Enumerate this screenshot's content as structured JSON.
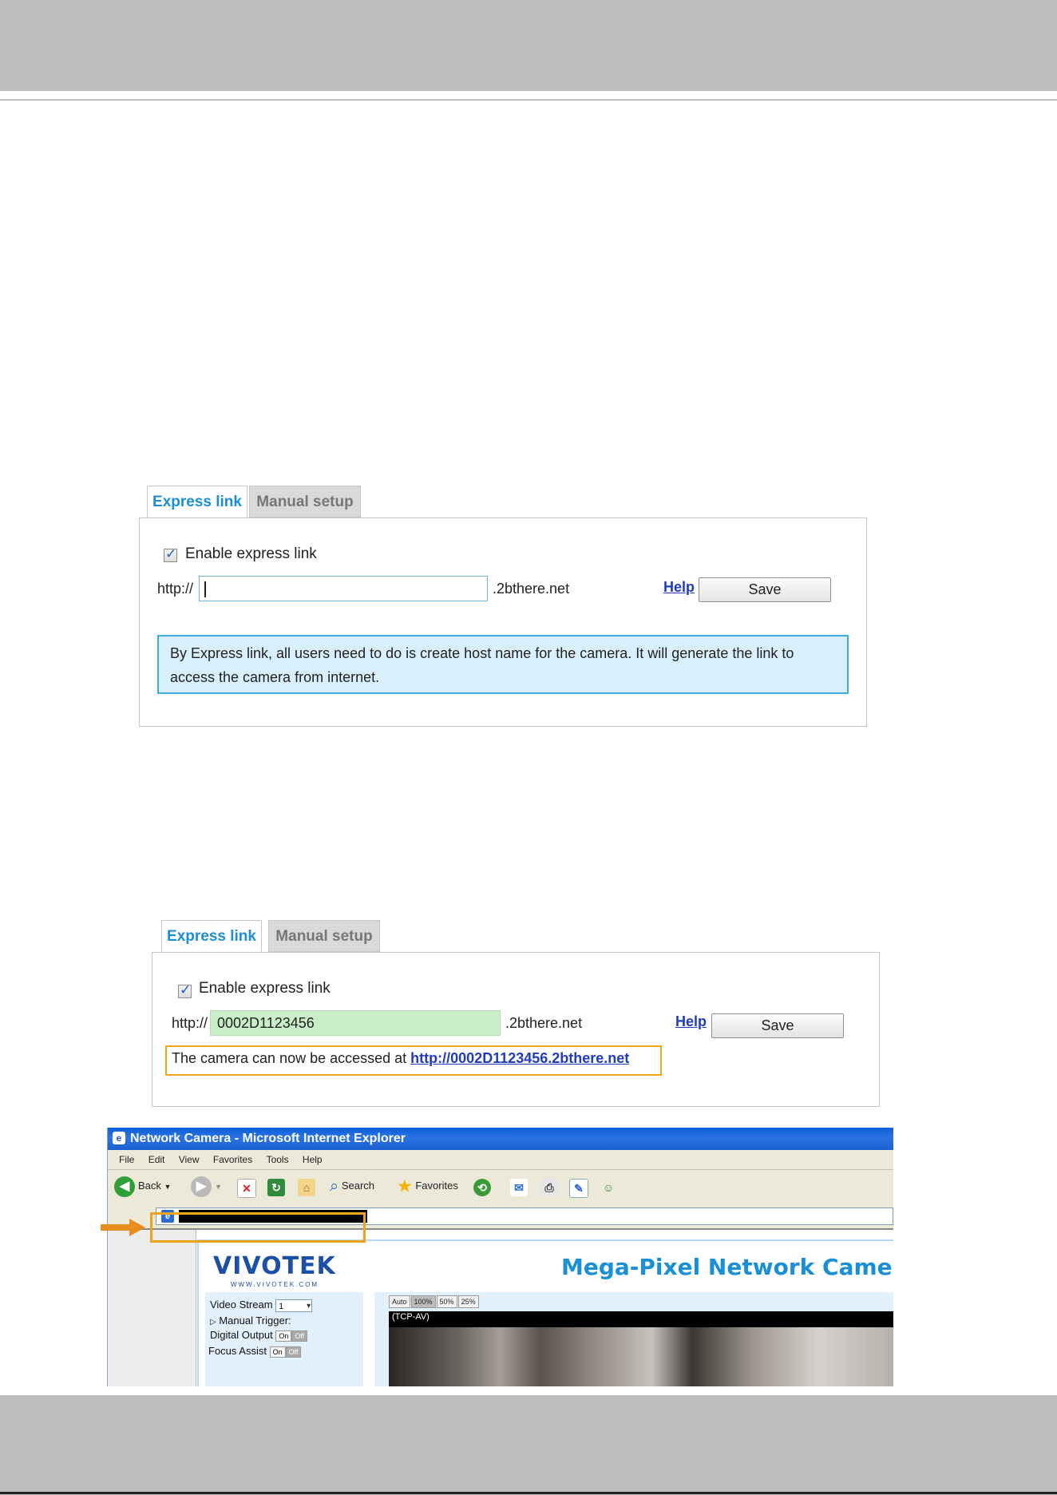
{
  "tabs": {
    "express": "Express link",
    "manual": "Manual setup"
  },
  "panel1": {
    "checkbox_label": "Enable express link",
    "prefix": "http://",
    "host_value": "",
    "suffix": ".2bthere.net",
    "help": "Help",
    "save": "Save",
    "info": "By Express link, all users need to do is create host name for the camera. It will generate the link to access the camera from internet."
  },
  "panel2": {
    "checkbox_label": "Enable express link",
    "prefix": "http://",
    "host_value": "0002D1123456",
    "suffix": ".2bthere.net",
    "help": "Help",
    "save": "Save",
    "notice_text": "The camera can now be accessed at ",
    "notice_link": "http://0002D1123456.2bthere.net"
  },
  "browser": {
    "title": "Network Camera - Microsoft Internet Explorer",
    "menu": [
      "File",
      "Edit",
      "View",
      "Favorites",
      "Tools",
      "Help"
    ],
    "toolbar": {
      "back": "Back",
      "search": "Search",
      "favorites": "Favorites"
    },
    "page": {
      "logo": "VIVOTEK",
      "logo_url": "WWW.VIVOTEK.COM",
      "title": "Mega-Pixel Network Camer",
      "video_stream_label": "Video Stream",
      "video_stream_value": "1",
      "manual_trigger": "Manual Trigger:",
      "digital_output": "Digital Output",
      "focus_assist": "Focus Assist",
      "on": "On",
      "off": "Off",
      "zoom": [
        "Auto",
        "100%",
        "50%",
        "25%"
      ],
      "stream_caption": "(TCP-AV)"
    }
  },
  "colors": {
    "accent": "#1a8fd6",
    "highlight": "#f0a31a",
    "info_bg": "#d8f0fb",
    "filled_field": "#c8efc8"
  }
}
